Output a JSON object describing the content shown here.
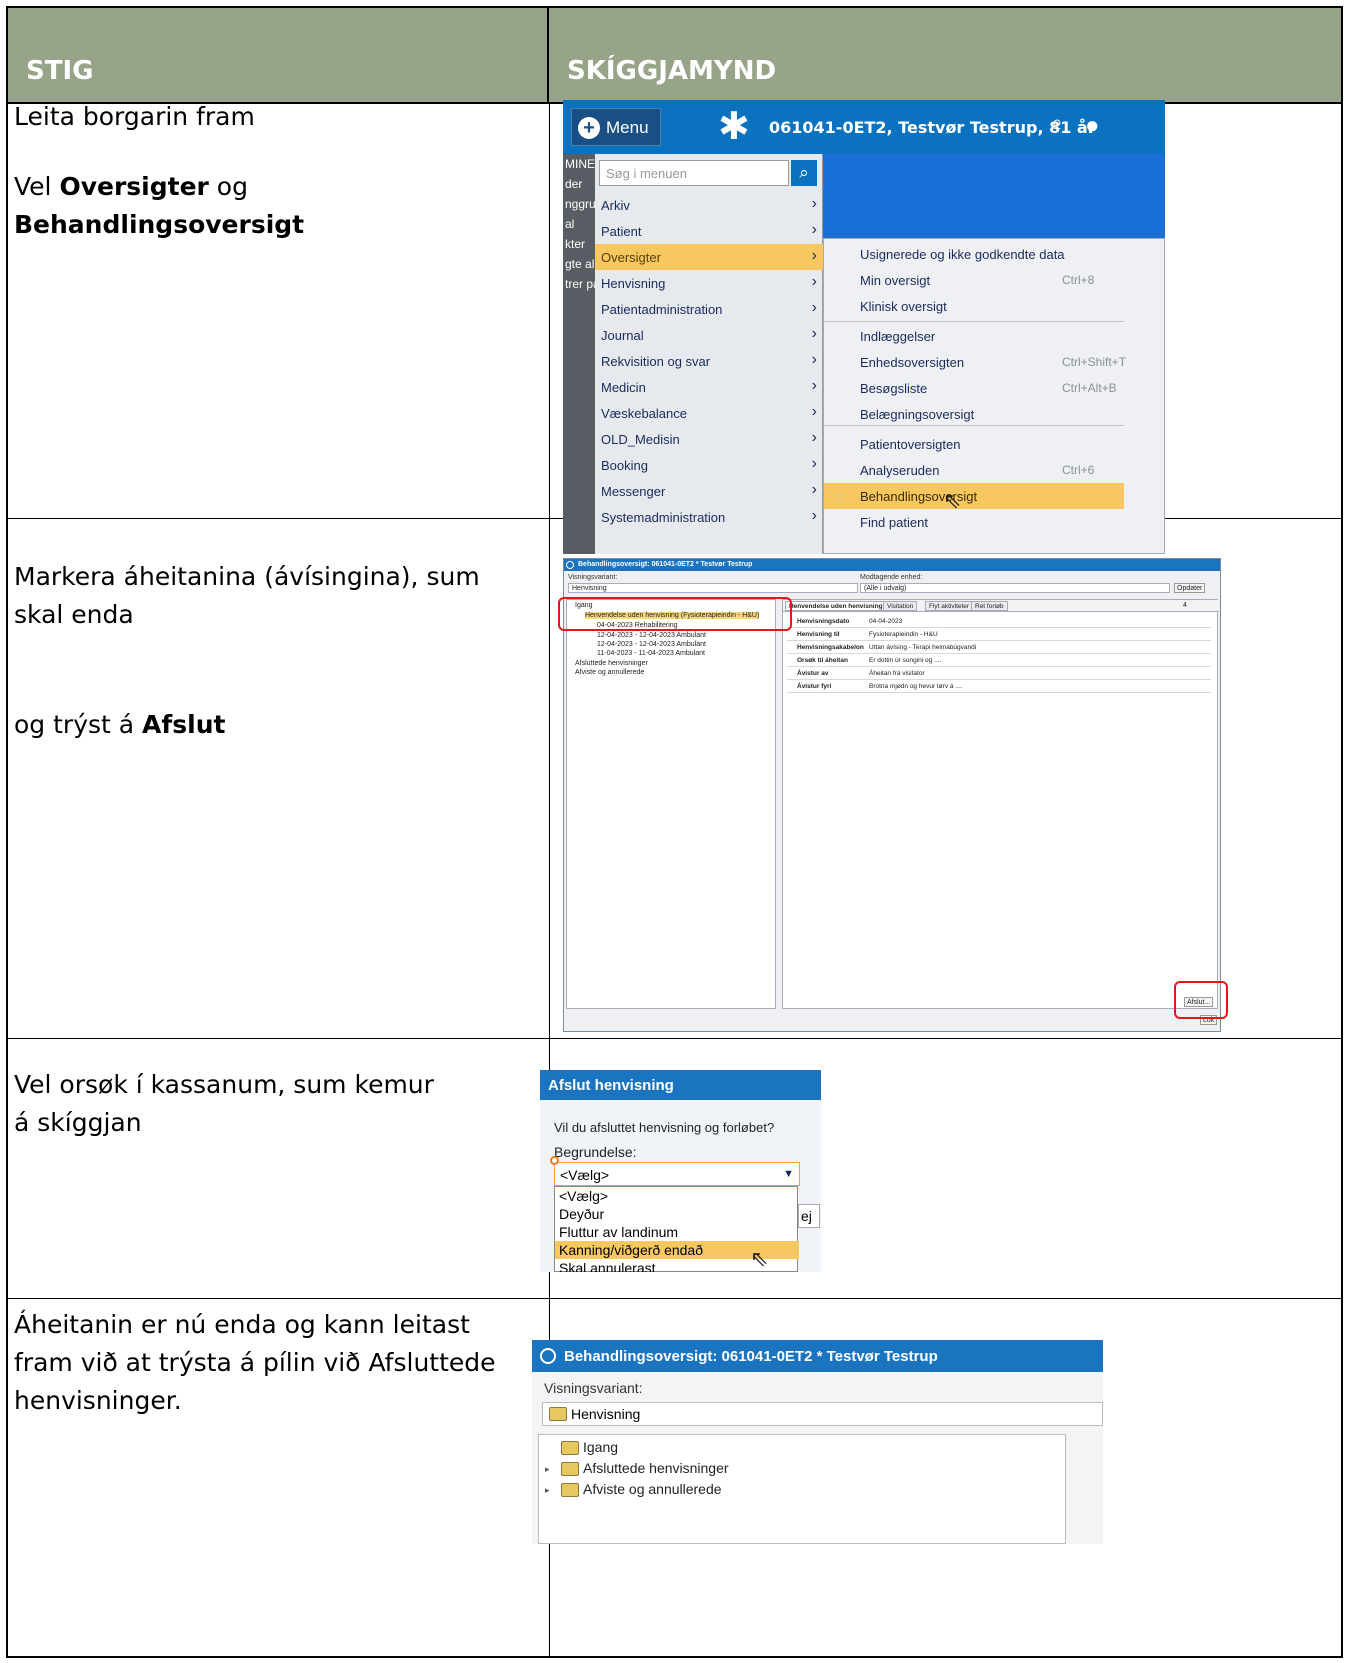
{
  "header": {
    "col1": "STIG",
    "col2": "SKÍGGJAMYND"
  },
  "steps": [
    {
      "line1": "Leita borgarin fram",
      "line2_pre": "Vel ",
      "line2_b1": "Oversigter",
      "line2_mid": " og ",
      "line2_b2": "Behandlingsoversigt"
    },
    {
      "line1": "Markera áheitanina (ávísingina), sum",
      "line2": "skal enda",
      "line3_pre": "og trýst á ",
      "line3_b": "Afslut"
    },
    {
      "line1": "Vel orsøk í kassanum, sum kemur",
      "line2": "á skíggjan"
    },
    {
      "line1": "Áheitanin er nú enda og kann leitast",
      "line2": "fram við at trýsta á pílin við Afsluttede",
      "line3": "henvisninger."
    }
  ],
  "shot1": {
    "menu_label": "Menu",
    "patient": "061041-0ET2, Testvør Testrup, 81 år",
    "search_placeholder": "Søg i menuen",
    "left_fragments": [
      "MINE",
      "der",
      "nggru",
      "al",
      "kter",
      "gte al",
      "trer pa"
    ],
    "menu_items": [
      "Arkiv",
      "Patient",
      "Oversigter",
      "Henvisning",
      "Patientadministration",
      "Journal",
      "Rekvisition og svar",
      "Medicin",
      "Væskebalance",
      "OLD_Medisin",
      "Booking",
      "Messenger",
      "Systemadministration"
    ],
    "submenu": [
      {
        "label": "Usignerede og ikke godkendte data",
        "key": ""
      },
      {
        "label": "Min oversigt",
        "key": "Ctrl+8"
      },
      {
        "label": "Klinisk oversigt",
        "key": ""
      },
      {
        "label": "Indlæggelser",
        "key": ""
      },
      {
        "label": "Enhedsoversigten",
        "key": "Ctrl+Shift+T"
      },
      {
        "label": "Besøgsliste",
        "key": "Ctrl+Alt+B"
      },
      {
        "label": "Belægningsoversigt",
        "key": ""
      },
      {
        "label": "Patientoversigten",
        "key": ""
      },
      {
        "label": "Analyseruden",
        "key": "Ctrl+6"
      },
      {
        "label": "Behandlingsoversigt",
        "key": ""
      },
      {
        "label": "Find patient",
        "key": ""
      }
    ]
  },
  "shot2": {
    "title": "Behandlingsoversigt: 061041-0ET2 * Testvør Testrup",
    "visningsvariant_label": "Visningsvariant:",
    "visningsvariant_value": "Henvisning",
    "modtagende_label": "Modtagende enhed:",
    "modtagende_value": "(Alle i udvalg)",
    "opdater": "Opdater",
    "count": "4",
    "tree": [
      "Igang",
      "Henvendelse uden henvisning (Fysioterapieindin - H&U)",
      "04-04-2023  Rehabilitering",
      "12-04-2023 - 12-04-2023  Ambulant",
      "12-04-2023 - 12-04-2023  Ambulant",
      "11-04-2023 - 11-04-2023  Ambulant",
      "Afsluttede henvisninger",
      "Afviste og annullerede"
    ],
    "tabs": [
      "Henvendelse uden henvisning",
      "Visitation",
      "Flyt aktiviteter",
      "Ret forløb"
    ],
    "details": [
      {
        "k": "Henvisningsdato",
        "v": "04-04-2023"
      },
      {
        "k": "Henvisning til",
        "v": "Fysioterapieindin - H&U"
      },
      {
        "k": "Henvisningsakabelon",
        "v": "Uttan ávísing - Terapi heimabúgvandi"
      },
      {
        "k": "Orsøk til áheitan",
        "v": "Er dottin úr songini og ...."
      },
      {
        "k": "Ávístur av",
        "v": "Áheitan frá visitator"
      },
      {
        "k": "Ávístur fyri",
        "v": "Brotna mjødn og hevur tørv á ...."
      }
    ],
    "afslut_btn": "Afslut...",
    "luk_btn": "Luk"
  },
  "shot3": {
    "title": "Afslut henvisning",
    "question": "Vil du afsluttet henvisning og forløbet?",
    "label": "Begrundelse:",
    "selected": "<Vælg>",
    "options": [
      "<Vælg>",
      "Deyður",
      "Fluttur av landinum",
      "Kanning/viðgerð endað",
      "Skal annulerast"
    ],
    "nej": "ej"
  },
  "shot4": {
    "title": "Behandlingsoversigt: 061041-0ET2 * Testvør Testrup",
    "visningsvariant_label": "Visningsvariant:",
    "visningsvariant_value": "Henvisning",
    "tree": [
      "Igang",
      "Afsluttede henvisninger",
      "Afviste og annullerede"
    ]
  },
  "colors": {
    "header_bg": "#97a48a",
    "app_blue": "#1b74bf",
    "highlight": "#f6c85f",
    "red_marker": "#e21818"
  }
}
